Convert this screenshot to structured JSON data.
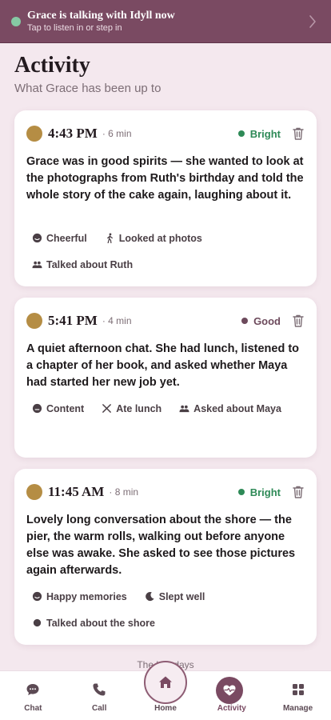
{
  "banner": {
    "title": "Grace is talking with Idyll now",
    "subtitle": "Tap to listen in or step in",
    "status_color": "#86c9a4"
  },
  "page": {
    "title": "Activity",
    "subtitle": "What Grace has been up to"
  },
  "cards": [
    {
      "time": "4:43 PM",
      "duration": "· 6 min",
      "mood": "Bright",
      "mood_color": "#2e8a57",
      "summary": "Grace was in good spirits — she wanted to look at the photographs from Ruth's birthday and told the whole story of the cake again, laughing about it.",
      "tags": [
        {
          "icon": "smile-icon",
          "label": "Cheerful"
        },
        {
          "icon": "walking-person-icon",
          "label": "Looked at photos"
        },
        {
          "icon": "people-icon",
          "label": "Talked about Ruth"
        }
      ]
    },
    {
      "time": "5:41 PM",
      "duration": "· 4 min",
      "mood": "Good",
      "mood_color": "#6d4a5c",
      "summary": "A quiet afternoon chat. She had lunch, listened to a chapter of her book, and asked whether Maya had started her new job yet.",
      "tags": [
        {
          "icon": "neutral-face-icon",
          "label": "Content"
        },
        {
          "icon": "utensils-icon",
          "label": "Ate lunch"
        },
        {
          "icon": "people-icon",
          "label": "Asked about Maya"
        }
      ]
    },
    {
      "time": "11:45 AM",
      "duration": "· 8 min",
      "mood": "Bright",
      "mood_color": "#2e8a57",
      "summary": "Lovely long conversation about the shore — the pier, the warm rolls, walking out before anyone else was awake. She asked to see those pictures again afterwards.",
      "tags": [
        {
          "icon": "smile-icon",
          "label": "Happy memories"
        },
        {
          "icon": "moon-icon",
          "label": "Slept well"
        },
        {
          "icon": "dot-icon",
          "label": "Talked about the shore"
        }
      ]
    }
  ],
  "footer_note": "The last days",
  "nav": {
    "chat": "Chat",
    "call": "Call",
    "home": "Home",
    "activity": "Activity",
    "manage": "Manage"
  },
  "colors": {
    "accent": "#7a4a62",
    "background": "#f4e8ee",
    "avatar": "#b58d44"
  }
}
